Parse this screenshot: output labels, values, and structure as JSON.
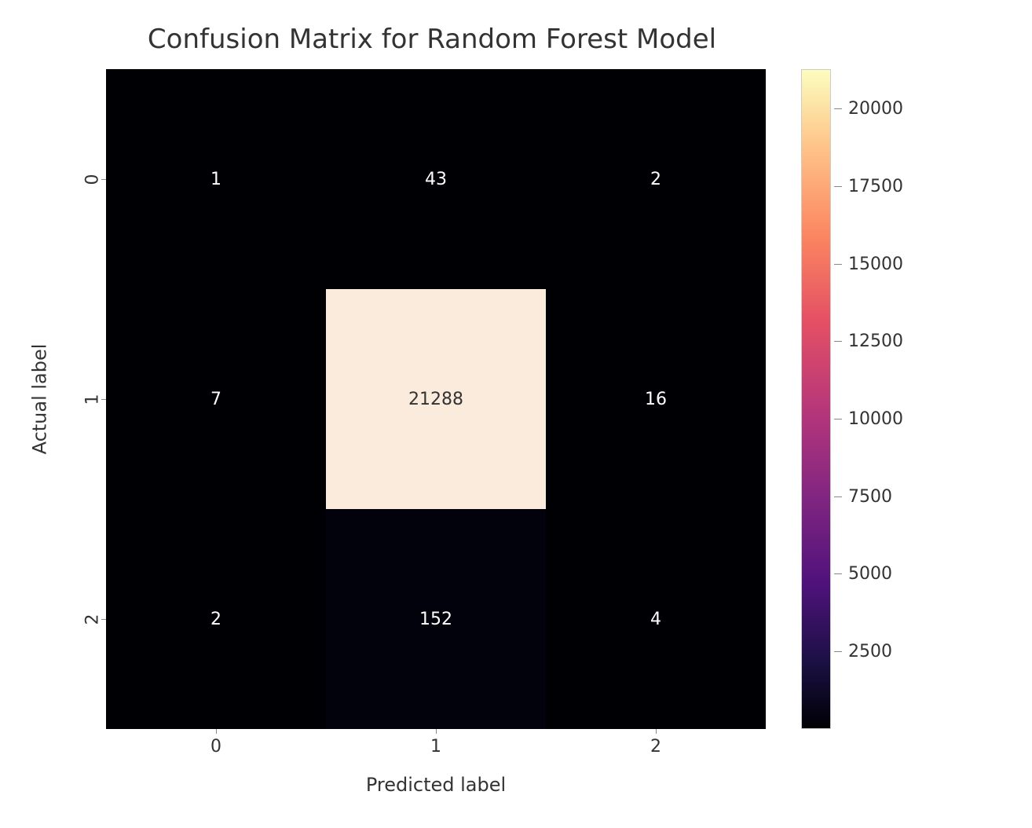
{
  "chart_data": {
    "type": "heatmap",
    "title": "Confusion Matrix for Random Forest Model",
    "xlabel": "Predicted label",
    "ylabel": "Actual label",
    "x_categories": [
      "0",
      "1",
      "2"
    ],
    "y_categories": [
      "0",
      "1",
      "2"
    ],
    "matrix": [
      [
        1,
        43,
        2
      ],
      [
        7,
        21288,
        16
      ],
      [
        2,
        152,
        4
      ]
    ],
    "colorbar_ticks": [
      2500,
      5000,
      7500,
      10000,
      12500,
      15000,
      17500,
      20000
    ],
    "vmin": 1,
    "vmax": 21288,
    "cmap": "magma"
  },
  "cells": [
    {
      "row": 0,
      "col": 0,
      "label": "1",
      "bg": "#000004",
      "fg": "#ffffff"
    },
    {
      "row": 0,
      "col": 1,
      "label": "43",
      "bg": "#000004",
      "fg": "#ffffff"
    },
    {
      "row": 0,
      "col": 2,
      "label": "2",
      "bg": "#000004",
      "fg": "#ffffff"
    },
    {
      "row": 1,
      "col": 0,
      "label": "7",
      "bg": "#000004",
      "fg": "#ffffff"
    },
    {
      "row": 1,
      "col": 1,
      "label": "21288",
      "bg": "#faebdc",
      "fg": "#333333"
    },
    {
      "row": 1,
      "col": 2,
      "label": "16",
      "bg": "#000004",
      "fg": "#ffffff"
    },
    {
      "row": 2,
      "col": 0,
      "label": "2",
      "bg": "#000004",
      "fg": "#ffffff"
    },
    {
      "row": 2,
      "col": 1,
      "label": "152",
      "bg": "#02020d",
      "fg": "#ffffff"
    },
    {
      "row": 2,
      "col": 2,
      "label": "4",
      "bg": "#000004",
      "fg": "#ffffff"
    }
  ],
  "cbar_labels": [
    "2500",
    "5000",
    "7500",
    "10000",
    "12500",
    "15000",
    "17500",
    "20000"
  ]
}
